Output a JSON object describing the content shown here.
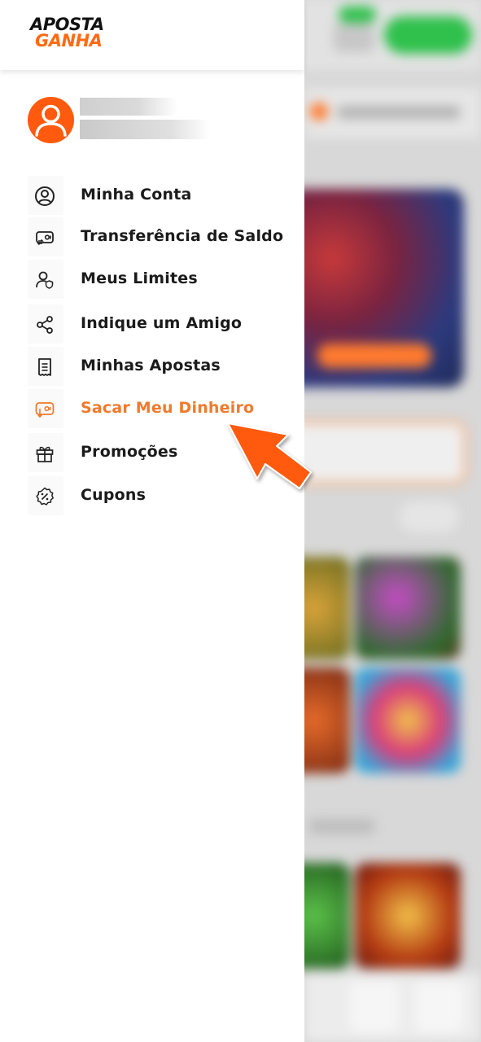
{
  "brand": {
    "line1": "APOSTA",
    "line2": "GANHA",
    "accent_color": "#ff6a13"
  },
  "menu": {
    "items": [
      {
        "label": "Minha Conta",
        "icon": "user-circle-icon",
        "active": false
      },
      {
        "label": "Transferência de Saldo",
        "icon": "transfer-icon",
        "active": false
      },
      {
        "label": "Meus Limites",
        "icon": "user-shield-icon",
        "active": false
      },
      {
        "label": "Indique um Amigo",
        "icon": "share-icon",
        "active": false
      },
      {
        "label": "Minhas Apostas",
        "icon": "ticket-icon",
        "active": false
      },
      {
        "label": "Sacar Meu Dinheiro",
        "icon": "withdraw-icon",
        "active": true
      },
      {
        "label": "Promoções",
        "icon": "gift-icon",
        "active": false
      },
      {
        "label": "Cupons",
        "icon": "coupon-icon",
        "active": false
      }
    ]
  },
  "colors": {
    "active_item": "#f07a2c",
    "avatar": "#ff5a0d",
    "pointer_arrow": "#ff5a0d"
  }
}
